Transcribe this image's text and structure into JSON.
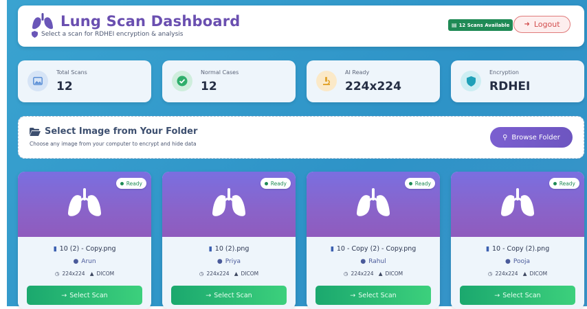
{
  "header": {
    "title": "Lung Scan Dashboard",
    "subtitle": "Select a scan for RDHEI encryption & analysis",
    "scans_badge": "12 Scans Available",
    "logout_label": "Logout"
  },
  "stats": [
    {
      "label": "Total Scans",
      "value": "12",
      "icon": "image-icon",
      "color": "#5b8fd6"
    },
    {
      "label": "Normal Cases",
      "value": "12",
      "icon": "check-circle-icon",
      "color": "#2fae6b"
    },
    {
      "label": "AI Ready",
      "value": "224x224",
      "icon": "microscope-icon",
      "color": "#e2a531"
    },
    {
      "label": "Encryption",
      "value": "RDHEI",
      "icon": "shield-icon",
      "color": "#1fa0b8"
    }
  ],
  "folder": {
    "title": "Select Image from Your Folder",
    "subtitle": "Choose any image from your computer to encrypt and hide data",
    "browse_label": "Browse Folder"
  },
  "cards": [
    {
      "status": "Ready",
      "filename": "10 (2) - Copy.png",
      "owner": "Arun",
      "size": "224x224",
      "format": "DICOM",
      "action": "Select Scan"
    },
    {
      "status": "Ready",
      "filename": "10 (2).png",
      "owner": "Priya",
      "size": "224x224",
      "format": "DICOM",
      "action": "Select Scan"
    },
    {
      "status": "Ready",
      "filename": "10 - Copy (2) - Copy.png",
      "owner": "Rahul",
      "size": "224x224",
      "format": "DICOM",
      "action": "Select Scan"
    },
    {
      "status": "Ready",
      "filename": "10 - Copy (2).png",
      "owner": "Pooja",
      "size": "224x224",
      "format": "DICOM",
      "action": "Select Scan"
    }
  ],
  "colors": {
    "accent": "#6a4fb0",
    "success": "#1f8a55",
    "danger": "#d24d4d"
  }
}
